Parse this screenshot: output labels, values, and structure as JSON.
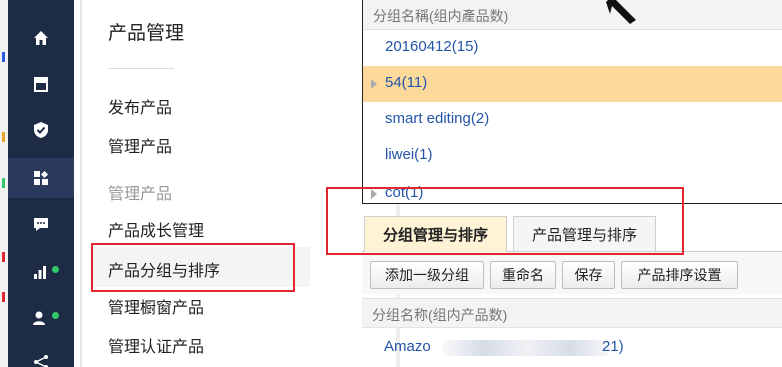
{
  "rail": {
    "icons": [
      "home-icon",
      "store-icon",
      "shield-icon",
      "apps-icon",
      "message-icon",
      "chart-icon",
      "users-icon",
      "share-icon"
    ],
    "active_icon": "apps-icon",
    "edge_marks": [
      "#2d5be3",
      "#e8a628",
      "#35c86a",
      "#e0262f",
      "#e0262f"
    ]
  },
  "subnav": {
    "title": "产品管理",
    "items": [
      {
        "label": "发布产品",
        "muted": false
      },
      {
        "label": "管理产品",
        "muted": false
      },
      {
        "label": "管理产品",
        "muted": true
      },
      {
        "label": "产品成长管理",
        "muted": false
      },
      {
        "label": "产品分组与排序",
        "muted": false,
        "active": true
      },
      {
        "label": "管理橱窗产品",
        "muted": false
      },
      {
        "label": "管理认证产品",
        "muted": false
      }
    ]
  },
  "top_list": {
    "header": "分组名稱(组内產品数)",
    "rows": [
      {
        "label": "20160412(15)",
        "selected": false,
        "arrow": false
      },
      {
        "label": "54(11)",
        "selected": true,
        "arrow": true
      },
      {
        "label": "smart editing(2)",
        "selected": false,
        "arrow": false
      },
      {
        "label": "liwei(1)",
        "selected": false,
        "arrow": false
      },
      {
        "label": "cot(1)",
        "selected": false,
        "arrow": true
      }
    ]
  },
  "tabs": [
    {
      "label": "分组管理与排序",
      "active": true
    },
    {
      "label": "产品管理与排序",
      "active": false
    }
  ],
  "toolbar": {
    "add_group": "添加一级分组",
    "rename": "重命名",
    "save": "保存",
    "sort_settings": "产品排序设置"
  },
  "bottom_list": {
    "header": "分组名称(组内产品数)",
    "row_start": "Amazo",
    "row_end": "21)"
  },
  "colors": {
    "rail_bg": "#1e2b45",
    "selected_row": "#fbd99b",
    "active_tab": "#fff3d6",
    "link": "#2455a8",
    "highlight_box": "#e0262f",
    "online_dot": "#35c86a"
  }
}
